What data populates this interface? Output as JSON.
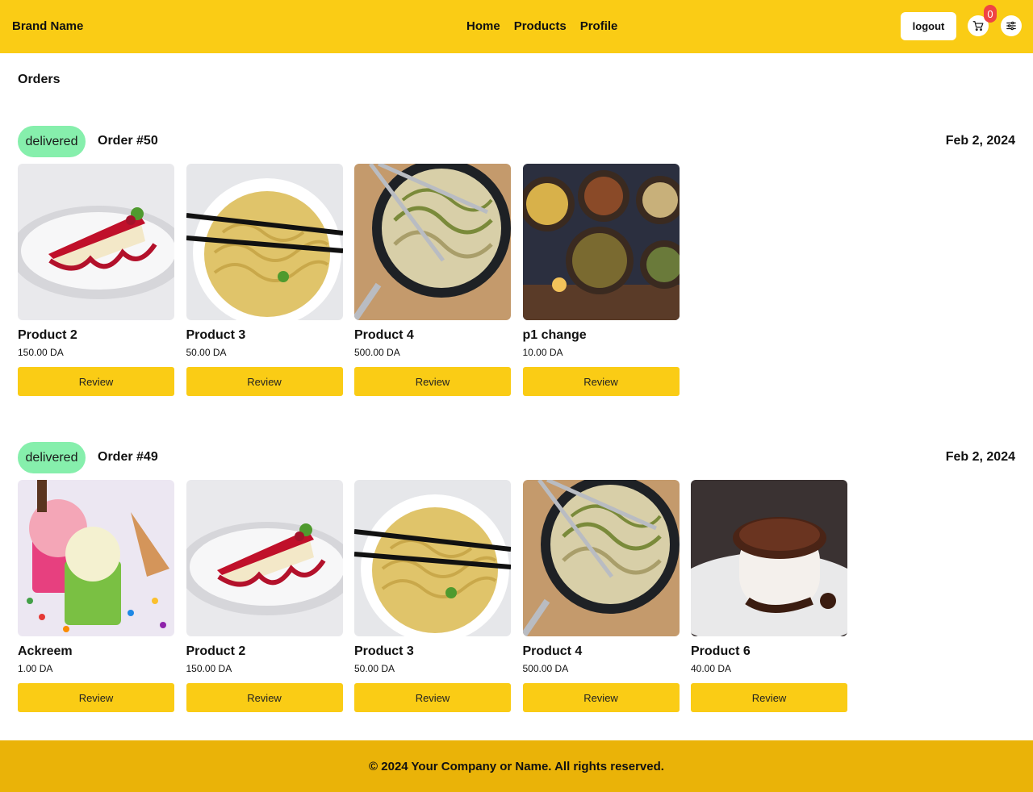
{
  "header": {
    "brand": "Brand Name",
    "nav": [
      "Home",
      "Products",
      "Profile"
    ],
    "logout_label": "logout",
    "cart_count": "0",
    "accent_color": "#facc15"
  },
  "page": {
    "title": "Orders"
  },
  "orders": [
    {
      "status": "delivered",
      "title": "Order #50",
      "date": "Feb 2, 2024",
      "items": [
        {
          "name": "Product 2",
          "price": "150.00 DA",
          "review_label": "Review",
          "image": "cheesecake"
        },
        {
          "name": "Product 3",
          "price": "50.00 DA",
          "review_label": "Review",
          "image": "noodles"
        },
        {
          "name": "Product 4",
          "price": "500.00 DA",
          "review_label": "Review",
          "image": "pan-pasta"
        },
        {
          "name": "p1 change",
          "price": "10.00 DA",
          "review_label": "Review",
          "image": "food-pots"
        }
      ]
    },
    {
      "status": "delivered",
      "title": "Order #49",
      "date": "Feb 2, 2024",
      "items": [
        {
          "name": "Ackreem",
          "price": "1.00 DA",
          "review_label": "Review",
          "image": "ice-cream"
        },
        {
          "name": "Product 2",
          "price": "150.00 DA",
          "review_label": "Review",
          "image": "cheesecake"
        },
        {
          "name": "Product 3",
          "price": "50.00 DA",
          "review_label": "Review",
          "image": "noodles"
        },
        {
          "name": "Product 4",
          "price": "500.00 DA",
          "review_label": "Review",
          "image": "pan-pasta"
        },
        {
          "name": "Product 6",
          "price": "40.00 DA",
          "review_label": "Review",
          "image": "chocolate-cake"
        }
      ]
    }
  ],
  "footer": {
    "text": "© 2024 Your Company or Name. All rights reserved."
  }
}
